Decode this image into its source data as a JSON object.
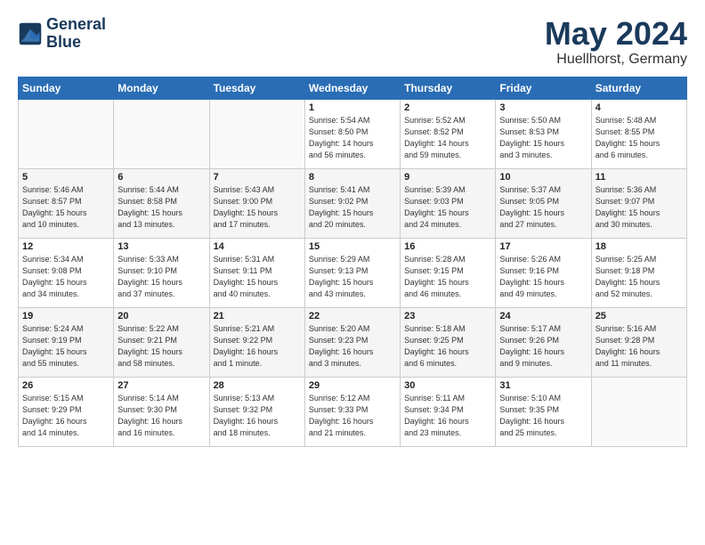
{
  "logo": {
    "line1": "General",
    "line2": "Blue"
  },
  "calendar": {
    "title": "May 2024",
    "subtitle": "Huellhorst, Germany"
  },
  "headers": [
    "Sunday",
    "Monday",
    "Tuesday",
    "Wednesday",
    "Thursday",
    "Friday",
    "Saturday"
  ],
  "weeks": [
    [
      {
        "day": "",
        "info": ""
      },
      {
        "day": "",
        "info": ""
      },
      {
        "day": "",
        "info": ""
      },
      {
        "day": "1",
        "info": "Sunrise: 5:54 AM\nSunset: 8:50 PM\nDaylight: 14 hours\nand 56 minutes."
      },
      {
        "day": "2",
        "info": "Sunrise: 5:52 AM\nSunset: 8:52 PM\nDaylight: 14 hours\nand 59 minutes."
      },
      {
        "day": "3",
        "info": "Sunrise: 5:50 AM\nSunset: 8:53 PM\nDaylight: 15 hours\nand 3 minutes."
      },
      {
        "day": "4",
        "info": "Sunrise: 5:48 AM\nSunset: 8:55 PM\nDaylight: 15 hours\nand 6 minutes."
      }
    ],
    [
      {
        "day": "5",
        "info": "Sunrise: 5:46 AM\nSunset: 8:57 PM\nDaylight: 15 hours\nand 10 minutes."
      },
      {
        "day": "6",
        "info": "Sunrise: 5:44 AM\nSunset: 8:58 PM\nDaylight: 15 hours\nand 13 minutes."
      },
      {
        "day": "7",
        "info": "Sunrise: 5:43 AM\nSunset: 9:00 PM\nDaylight: 15 hours\nand 17 minutes."
      },
      {
        "day": "8",
        "info": "Sunrise: 5:41 AM\nSunset: 9:02 PM\nDaylight: 15 hours\nand 20 minutes."
      },
      {
        "day": "9",
        "info": "Sunrise: 5:39 AM\nSunset: 9:03 PM\nDaylight: 15 hours\nand 24 minutes."
      },
      {
        "day": "10",
        "info": "Sunrise: 5:37 AM\nSunset: 9:05 PM\nDaylight: 15 hours\nand 27 minutes."
      },
      {
        "day": "11",
        "info": "Sunrise: 5:36 AM\nSunset: 9:07 PM\nDaylight: 15 hours\nand 30 minutes."
      }
    ],
    [
      {
        "day": "12",
        "info": "Sunrise: 5:34 AM\nSunset: 9:08 PM\nDaylight: 15 hours\nand 34 minutes."
      },
      {
        "day": "13",
        "info": "Sunrise: 5:33 AM\nSunset: 9:10 PM\nDaylight: 15 hours\nand 37 minutes."
      },
      {
        "day": "14",
        "info": "Sunrise: 5:31 AM\nSunset: 9:11 PM\nDaylight: 15 hours\nand 40 minutes."
      },
      {
        "day": "15",
        "info": "Sunrise: 5:29 AM\nSunset: 9:13 PM\nDaylight: 15 hours\nand 43 minutes."
      },
      {
        "day": "16",
        "info": "Sunrise: 5:28 AM\nSunset: 9:15 PM\nDaylight: 15 hours\nand 46 minutes."
      },
      {
        "day": "17",
        "info": "Sunrise: 5:26 AM\nSunset: 9:16 PM\nDaylight: 15 hours\nand 49 minutes."
      },
      {
        "day": "18",
        "info": "Sunrise: 5:25 AM\nSunset: 9:18 PM\nDaylight: 15 hours\nand 52 minutes."
      }
    ],
    [
      {
        "day": "19",
        "info": "Sunrise: 5:24 AM\nSunset: 9:19 PM\nDaylight: 15 hours\nand 55 minutes."
      },
      {
        "day": "20",
        "info": "Sunrise: 5:22 AM\nSunset: 9:21 PM\nDaylight: 15 hours\nand 58 minutes."
      },
      {
        "day": "21",
        "info": "Sunrise: 5:21 AM\nSunset: 9:22 PM\nDaylight: 16 hours\nand 1 minute."
      },
      {
        "day": "22",
        "info": "Sunrise: 5:20 AM\nSunset: 9:23 PM\nDaylight: 16 hours\nand 3 minutes."
      },
      {
        "day": "23",
        "info": "Sunrise: 5:18 AM\nSunset: 9:25 PM\nDaylight: 16 hours\nand 6 minutes."
      },
      {
        "day": "24",
        "info": "Sunrise: 5:17 AM\nSunset: 9:26 PM\nDaylight: 16 hours\nand 9 minutes."
      },
      {
        "day": "25",
        "info": "Sunrise: 5:16 AM\nSunset: 9:28 PM\nDaylight: 16 hours\nand 11 minutes."
      }
    ],
    [
      {
        "day": "26",
        "info": "Sunrise: 5:15 AM\nSunset: 9:29 PM\nDaylight: 16 hours\nand 14 minutes."
      },
      {
        "day": "27",
        "info": "Sunrise: 5:14 AM\nSunset: 9:30 PM\nDaylight: 16 hours\nand 16 minutes."
      },
      {
        "day": "28",
        "info": "Sunrise: 5:13 AM\nSunset: 9:32 PM\nDaylight: 16 hours\nand 18 minutes."
      },
      {
        "day": "29",
        "info": "Sunrise: 5:12 AM\nSunset: 9:33 PM\nDaylight: 16 hours\nand 21 minutes."
      },
      {
        "day": "30",
        "info": "Sunrise: 5:11 AM\nSunset: 9:34 PM\nDaylight: 16 hours\nand 23 minutes."
      },
      {
        "day": "31",
        "info": "Sunrise: 5:10 AM\nSunset: 9:35 PM\nDaylight: 16 hours\nand 25 minutes."
      },
      {
        "day": "",
        "info": ""
      }
    ]
  ]
}
